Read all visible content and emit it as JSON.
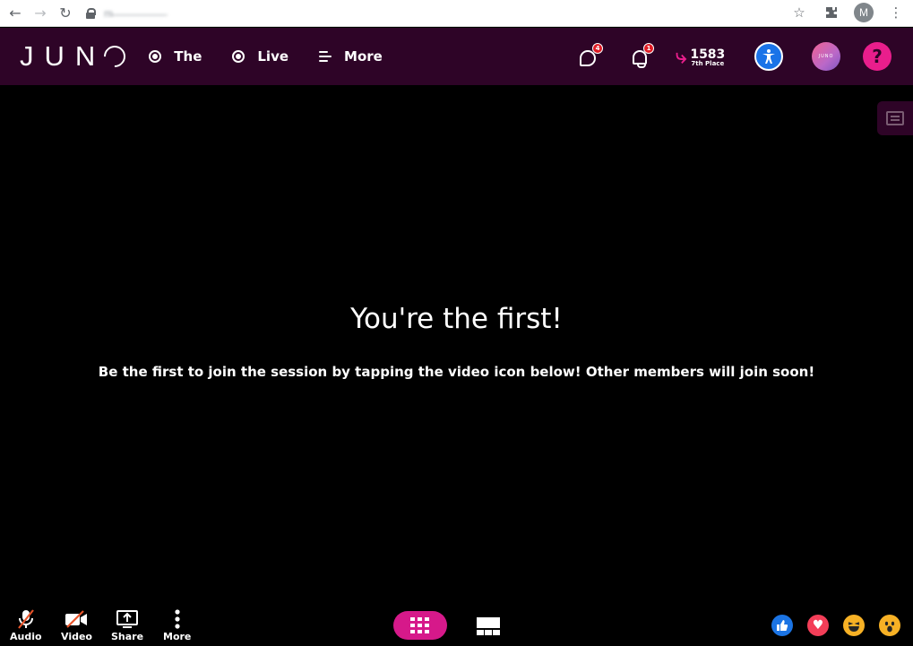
{
  "browser": {
    "url_blurred": "m̶ ̶ ̶ ̶ ̶ ̶ ̶ ̶ ̶ ̶ ̶ ̶ ̶ ̶ ̶ ̶",
    "profile_initial": "M"
  },
  "header": {
    "logo": "JUN",
    "nav": [
      {
        "label": "The",
        "icon": "radio-icon"
      },
      {
        "label": "Live",
        "icon": "radio-icon"
      },
      {
        "label": "More",
        "icon": "menu-lines-icon"
      }
    ],
    "messages_badge": "4",
    "notifications_badge": "1",
    "points": "1583",
    "rank": "7th Place",
    "avatar_text": "JUNO",
    "help_label": "?"
  },
  "main": {
    "title": "You're the first!",
    "subtitle": "Be the first to join the session by tapping the video icon below! Other members will join soon!"
  },
  "controls": [
    {
      "label": "Audio",
      "icon": "mic-off-icon"
    },
    {
      "label": "Video",
      "icon": "video-off-icon"
    },
    {
      "label": "Share",
      "icon": "share-screen-icon"
    },
    {
      "label": "More",
      "icon": "more-vertical-icon"
    }
  ],
  "reactions": [
    "thumbs-up-icon",
    "heart-icon",
    "laugh-icon",
    "wow-icon"
  ],
  "colors": {
    "header_bg": "#2e0427",
    "accent": "#d6198a",
    "badge": "#e01b24",
    "accessibility": "#1a73e8"
  }
}
